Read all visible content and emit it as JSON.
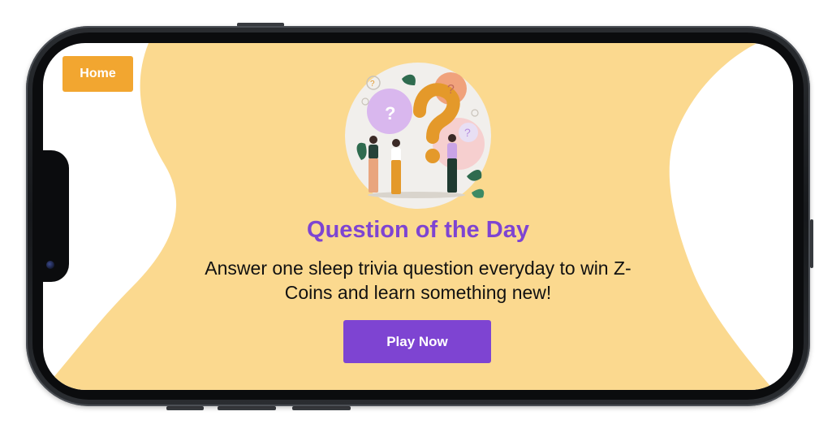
{
  "home": {
    "label": "Home"
  },
  "card": {
    "title": "Question of the Day",
    "subtitle": "Answer one sleep trivia question everyday to win Z-Coins and learn something new!",
    "play_label": "Play Now"
  },
  "illustration": {
    "question_marks": [
      "?",
      "?",
      "?",
      "?"
    ]
  },
  "icons": {
    "illustration": "question-marks-people-illustration",
    "camera": "front-camera-icon"
  },
  "colors": {
    "accent_purple": "#7e44d2",
    "home_orange": "#f2a630",
    "blob_yellow": "#fbd98f",
    "question_mark_orange": "#e4992a"
  }
}
